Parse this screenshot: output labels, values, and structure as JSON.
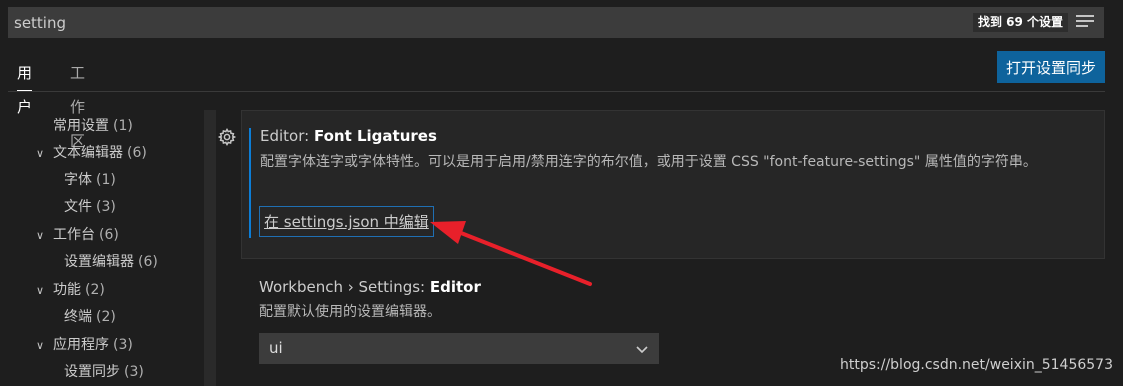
{
  "search": {
    "value": "setting",
    "result_count": "找到 69 个设置"
  },
  "tabs": [
    {
      "label": "用户"
    },
    {
      "label": "工作区"
    }
  ],
  "sync_button": {
    "label": "打开设置同步"
  },
  "toc": [
    {
      "label": "常用设置",
      "count": "(1)"
    },
    {
      "label": "文本编辑器",
      "count": "(6)"
    },
    {
      "label": "字体",
      "count": "(1)"
    },
    {
      "label": "文件",
      "count": "(3)"
    },
    {
      "label": "工作台",
      "count": "(6)"
    },
    {
      "label": "设置编辑器",
      "count": "(6)"
    },
    {
      "label": "功能",
      "count": "(2)"
    },
    {
      "label": "终端",
      "count": "(2)"
    },
    {
      "label": "应用程序",
      "count": "(3)"
    },
    {
      "label": "设置同步",
      "count": "(3)"
    }
  ],
  "setting1": {
    "category": "Editor: ",
    "name": "Font Ligatures",
    "description": "配置字体连字或字体特性。可以是用于启用/禁用连字的布尔值，或用于设置 CSS \"font-feature-settings\" 属性值的字符串。",
    "edit_link": "在 settings.json 中编辑"
  },
  "setting2": {
    "category": "Workbench › Settings: ",
    "name": "Editor",
    "description": "配置默认使用的设置编辑器。",
    "value": "ui"
  },
  "watermark": "https://blog.csdn.net/weixin_51456573",
  "colors": {
    "accent": "#0e639c",
    "annotation_arrow": "#e8202a",
    "focus_border": "#1f6fb3"
  }
}
